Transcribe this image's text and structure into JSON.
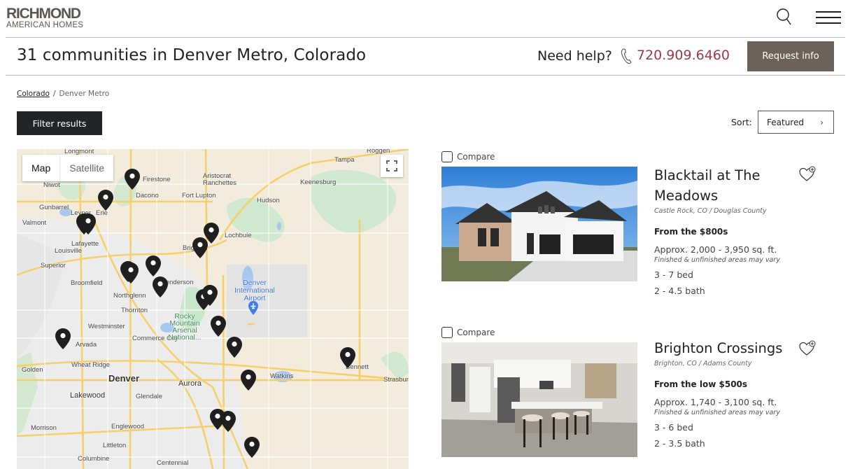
{
  "brand": {
    "name_line1": "RICHMOND",
    "name_line2": "AMERICAN HOMES"
  },
  "nav": {
    "search_icon": "search-icon",
    "menu_icon": "hamburger-menu-icon"
  },
  "header": {
    "title": "31 communities in Denver Metro, Colorado",
    "help_label": "Need help?",
    "phone": "720.909.6460",
    "phone_icon": "phone-icon",
    "request_label": "Request info",
    "accent_color": "#9a3b48",
    "button_color": "#6b625c"
  },
  "breadcrumb": [
    {
      "label": "Colorado",
      "link": true
    },
    {
      "label": "Denver Metro",
      "link": false
    }
  ],
  "toolbar": {
    "filter_label": "Filter results",
    "sort_label": "Sort:",
    "sort_value": "Featured"
  },
  "map": {
    "tabs": [
      {
        "label": "Map",
        "active": true
      },
      {
        "label": "Satellite",
        "active": false
      }
    ],
    "place_labels": [
      "Longmont",
      "Niwot",
      "Gunbarrel",
      "Leyner",
      "Erie",
      "Valmont",
      "Lafayette",
      "Louisville",
      "Superior",
      "Broomfield",
      "Northglenn",
      "Thornton",
      "Westminster",
      "Arvada",
      "Wheat Ridge",
      "Golden",
      "Denver",
      "Lakewood",
      "Glendale",
      "Aurora",
      "Englewood",
      "Littleton",
      "Columbine",
      "Centennial",
      "Morrison",
      "Commerce City",
      "Henderson",
      "Brighton",
      "Lochbuie",
      "Dacono",
      "Firestone",
      "Fort Lupton",
      "Aristocrat Ranchettes",
      "Hudson",
      "Keenesburg",
      "Tampa",
      "Roggen",
      "Watkins",
      "Bennett",
      "Strasburg",
      "Denver International Airport",
      "Rocky Mountain Arsenal National..."
    ],
    "pin_count": 22
  },
  "communities": [
    {
      "compare_label": "Compare",
      "name": "Blacktail at The Meadows",
      "location": "Castle Rock, CO / Douglas County",
      "price": "From the $800s",
      "sqft": "Approx. 2,000 - 3,950 sq. ft.",
      "note": "Finished & unfinished areas may vary",
      "beds": "3 - 7 bed",
      "baths": "2 - 4.5 bath",
      "photo": "exterior-house-photo"
    },
    {
      "compare_label": "Compare",
      "name": "Brighton Crossings",
      "location": "Brighton, CO / Adams County",
      "price": "From the low $500s",
      "sqft": "Approx. 1,740 - 3,100 sq. ft.",
      "note": "Finished & unfinished areas may vary",
      "beds": "3 - 6 bed",
      "baths": "2 - 3.5 bath",
      "photo": "kitchen-interior-photo"
    }
  ]
}
